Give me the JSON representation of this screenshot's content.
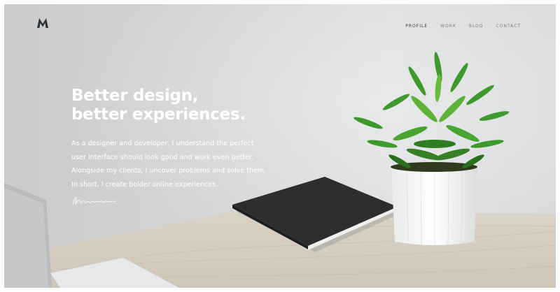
{
  "brand": {
    "logo_icon": "m-logo-icon"
  },
  "nav": {
    "items": [
      {
        "label": "PROFILE",
        "active": true
      },
      {
        "label": "WORK",
        "active": false
      },
      {
        "label": "BLOG",
        "active": false
      },
      {
        "label": "CONTACT",
        "active": false
      }
    ]
  },
  "hero": {
    "headline_line1": "Better design,",
    "headline_line2": "better experiences.",
    "intro_lines": [
      "As a designer and developer, I understand the perfect",
      "user interface should look good and work even better.",
      "Alongside my clients, I uncover problems and solve them.",
      "In short, I create bolder online experiences."
    ]
  },
  "colors": {
    "wall": "#d5d7d9",
    "text_primary": "#ffffff",
    "nav_text": "#7d8184",
    "nav_active": "#2d3134",
    "leaf": "#3f9a2e"
  }
}
